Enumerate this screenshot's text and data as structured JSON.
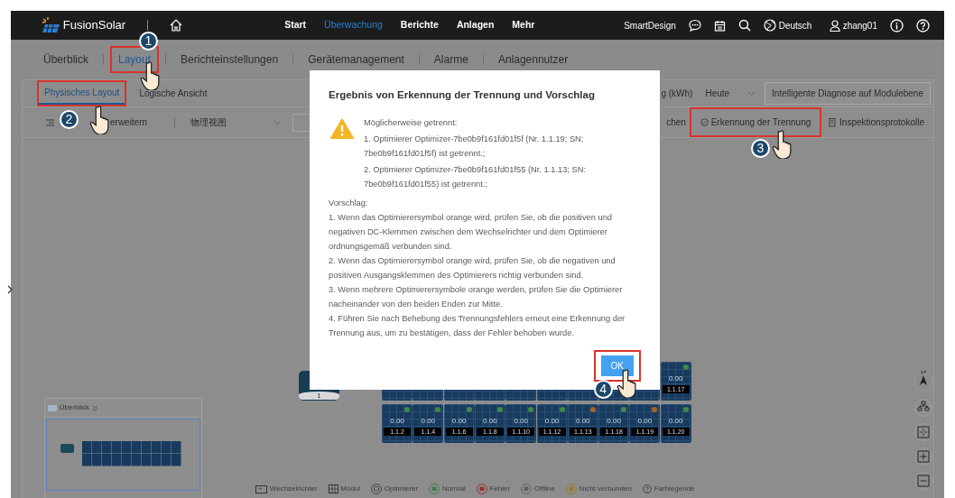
{
  "header": {
    "brand": "FusionSolar",
    "menu": [
      {
        "label": "Start",
        "selected": false
      },
      {
        "label": "Überwachung",
        "selected": true
      },
      {
        "label": "Berichte",
        "selected": false
      },
      {
        "label": "Anlagen",
        "selected": false
      },
      {
        "label": "Mehr",
        "selected": false
      }
    ],
    "smartdesign": "SmartDesign",
    "language": "Deutsch",
    "user": "zhang01"
  },
  "tabs": [
    {
      "label": "Überblick",
      "selected": false,
      "highlighted": false
    },
    {
      "label": "Layout",
      "selected": true,
      "highlighted": true,
      "step": "1"
    },
    {
      "label": "Berichteinstellungen",
      "selected": false,
      "highlighted": false
    },
    {
      "label": "Gerätemanagement",
      "selected": false,
      "highlighted": false
    },
    {
      "label": "Alarme",
      "selected": false,
      "highlighted": false
    },
    {
      "label": "Anlagennutzer",
      "selected": false,
      "highlighted": false
    }
  ],
  "view_tabs": [
    {
      "label": "Physisches Layout",
      "selected": true,
      "highlighted": true,
      "step": "2"
    },
    {
      "label": "Logische Ansicht",
      "selected": false,
      "highlighted": false
    }
  ],
  "toolbar_top": {
    "energy_label": "g (kWh)",
    "period": "Heute",
    "diagnose_button": "Intelligente Diagnose auf Modulebene"
  },
  "toolbar": {
    "expand_label": "erweitern",
    "view_select": "物理视图",
    "partial_label": "chen",
    "actions": [
      {
        "label": "Erkennung der Trennung",
        "kind": "detect",
        "highlighted": true,
        "step": "3"
      },
      {
        "label": "Inspektionsprotokolle",
        "kind": "report",
        "highlighted": false
      }
    ]
  },
  "modal": {
    "title": "Ergebnis von Erkennung der Trennung und Vorschlag",
    "warning_heading": "Möglicherweise getrennt:",
    "warnings": [
      "1. Optimierer Optimizer-7be0b9f161fd01f5f (Nr. 1.1.19; SN: 7be0b9f161fd01f5f) ist getrennt.;",
      "2. Optimierer Optimizer-7be0b9f161fd01f55 (Nr. 1.1.13; SN: 7be0b9f161fd01f55) ist getrennt.;"
    ],
    "suggestion_heading": "Vorschlag:",
    "suggestions": [
      "1. Wenn das Optimierersymbol orange wird, prüfen Sie, ob die positiven und negativen DC-Klemmen zwischen dem Wechselrichter und dem Optimierer ordnungsgemäß verbunden sind.",
      "2. Wenn das Optimierersymbol orange wird, prüfen Sie, ob die negativen und positiven Ausgangsklemmen des Optimierers richtig verbunden sind.",
      "3. Wenn mehrere Optimierersymbole orange werden, prüfen Sie die Optimierer nacheinander von den beiden Enden zur Mitte.",
      "4. Führen Sie nach Behebung des Trennungsfehlers erneut eine Erkennung der Trennung aus, um zu bestätigen, dass der Fehler behoben wurde."
    ],
    "ok_button": {
      "label": "OK",
      "highlighted": true,
      "step": "4"
    }
  },
  "inverter": {
    "label": "1"
  },
  "modules_top": [
    {
      "value": "0.00",
      "label": "1.1.17",
      "color": "#3f8a46"
    }
  ],
  "modules_bottom": [
    {
      "value": "0.00",
      "label": "1.1.2",
      "color": "#3f8a46"
    },
    {
      "value": "0.00",
      "label": "1.1.4",
      "color": "#3f8a46"
    },
    {
      "value": "0.00",
      "label": "1.1.6",
      "color": "#3f8a46"
    },
    {
      "value": "0.00",
      "label": "1.1.8",
      "color": "#3f8a46"
    },
    {
      "value": "0.00",
      "label": "1.1.10",
      "color": "#3f8a46"
    },
    {
      "value": "0.00",
      "label": "1.1.12",
      "color": "#3f8a46"
    },
    {
      "value": "0.00",
      "label": "1.1.13",
      "color": "#a8651e"
    },
    {
      "value": "0.00",
      "label": "1.1.18",
      "color": "#3f8a46"
    },
    {
      "value": "0.00",
      "label": "1.1.19",
      "color": "#a8651e"
    },
    {
      "value": "0.00",
      "label": "1.1.20",
      "color": "#3f8a46"
    }
  ],
  "minimap": {
    "title": "Überblick"
  },
  "legend": [
    {
      "label": "Wechselrichter",
      "kind": "inverter"
    },
    {
      "label": "Modul",
      "kind": "module"
    },
    {
      "label": "Optimierer",
      "kind": "optimizer"
    },
    {
      "label": "Normal",
      "kind": "status",
      "color": "#3a7e45"
    },
    {
      "label": "Fehler",
      "kind": "status",
      "color": "#9e2c2c"
    },
    {
      "label": "Offline",
      "kind": "status",
      "color": "#606060"
    },
    {
      "label": "Nicht verbunden",
      "kind": "status",
      "color": "#9a7a1c"
    },
    {
      "label": "Farblegende",
      "kind": "help"
    }
  ]
}
